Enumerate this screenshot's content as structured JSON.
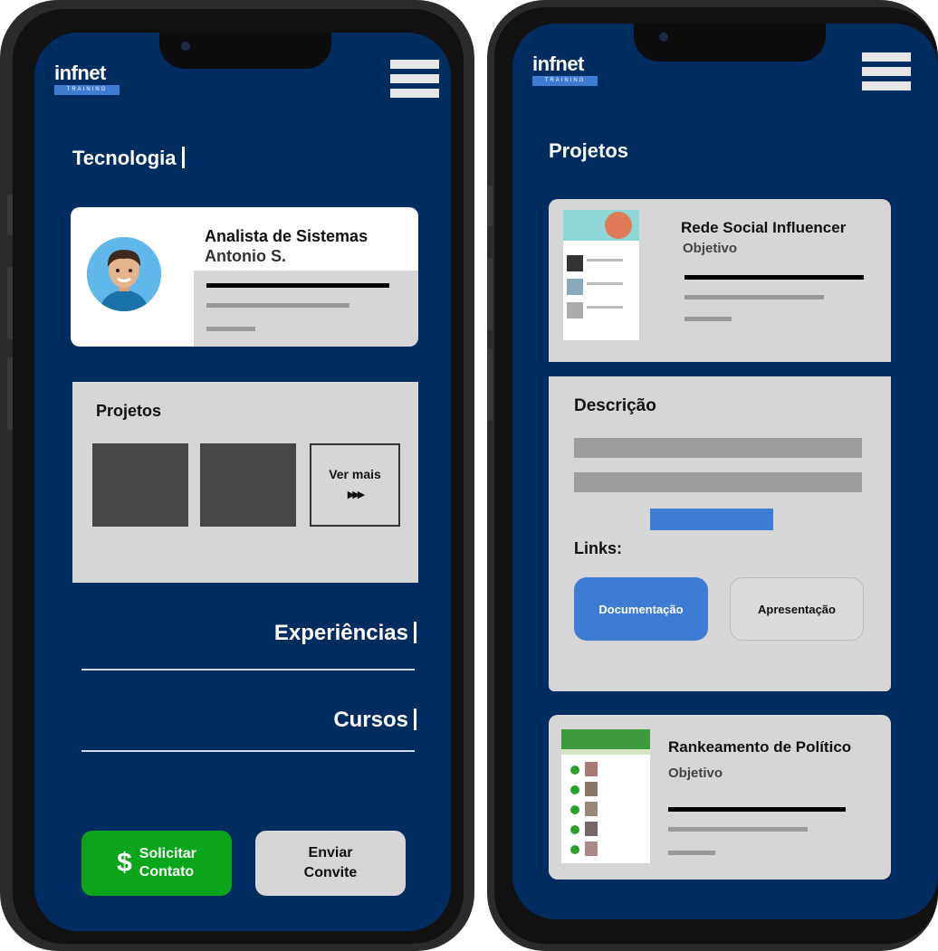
{
  "left": {
    "logo": {
      "word": "infnet",
      "tag": "TRAINING"
    },
    "section_title": "Tecnologia",
    "profile": {
      "role": "Analista de Sistemas",
      "name": "Antonio S."
    },
    "projects": {
      "title": "Projetos",
      "see_more": "Ver mais",
      "see_more_glyph": "▶▶▶"
    },
    "experiences_label": "Experiências",
    "courses_label": "Cursos",
    "contact_button": {
      "icon": "$",
      "line1": "Solicitar",
      "line2": "Contato"
    },
    "invite_button": {
      "line1": "Enviar",
      "line2": "Convite"
    }
  },
  "right": {
    "logo": {
      "word": "infnet",
      "tag": "TRAINING"
    },
    "section_title": "Projetos",
    "project1": {
      "title": "Rede Social Influencer",
      "subtitle": "Objetivo"
    },
    "description_title": "Descrição",
    "links_title": "Links:",
    "doc_button": "Documentação",
    "pres_button": "Apresentação",
    "project2": {
      "title": "Rankeamento de Político",
      "subtitle": "Objetivo"
    }
  },
  "colors": {
    "screen_bg": "#002c5f",
    "panel_gray": "#d6d6d6",
    "accent_blue": "#3e7bd3",
    "cta_green": "#0aa51a"
  }
}
